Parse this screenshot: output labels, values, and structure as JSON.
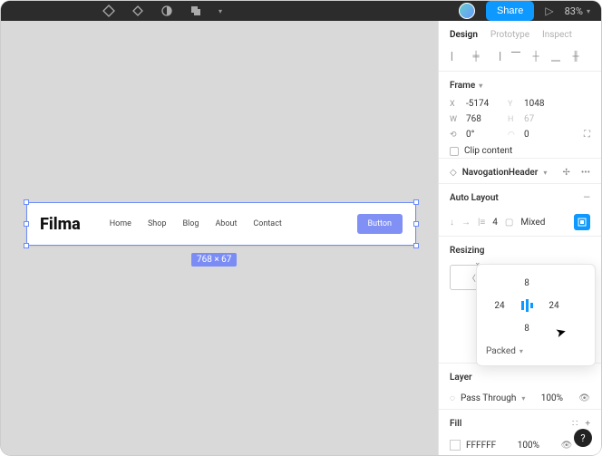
{
  "topbar": {
    "share_label": "Share",
    "zoom": "83%"
  },
  "panel": {
    "tabs": {
      "design": "Design",
      "prototype": "Prototype",
      "inspect": "Inspect"
    },
    "frame": {
      "title": "Frame",
      "x_label": "X",
      "x": "-5174",
      "y_label": "Y",
      "y": "1048",
      "w_label": "W",
      "w": "768",
      "h_label": "H",
      "h": "67",
      "rotation": "0°",
      "radius": "0",
      "clip": "Clip content"
    },
    "component": {
      "name": "NavogationHeader"
    },
    "autolayout": {
      "title": "Auto Layout",
      "gap": "4",
      "padding_mode": "Mixed"
    },
    "popover": {
      "top": "8",
      "right": "24",
      "bottom": "8",
      "left": "24",
      "packed": "Packed"
    },
    "resizing": {
      "title": "Resizing"
    },
    "layer": {
      "title": "Layer",
      "blend": "Pass Through",
      "opacity": "100%"
    },
    "fill": {
      "title": "Fill",
      "hex": "FFFFFF",
      "opacity": "100%"
    }
  },
  "canvas": {
    "logo": "Filma",
    "nav": [
      "Home",
      "Shop",
      "Blog",
      "About",
      "Contact"
    ],
    "button": "Button",
    "badge": "768 × 67"
  }
}
